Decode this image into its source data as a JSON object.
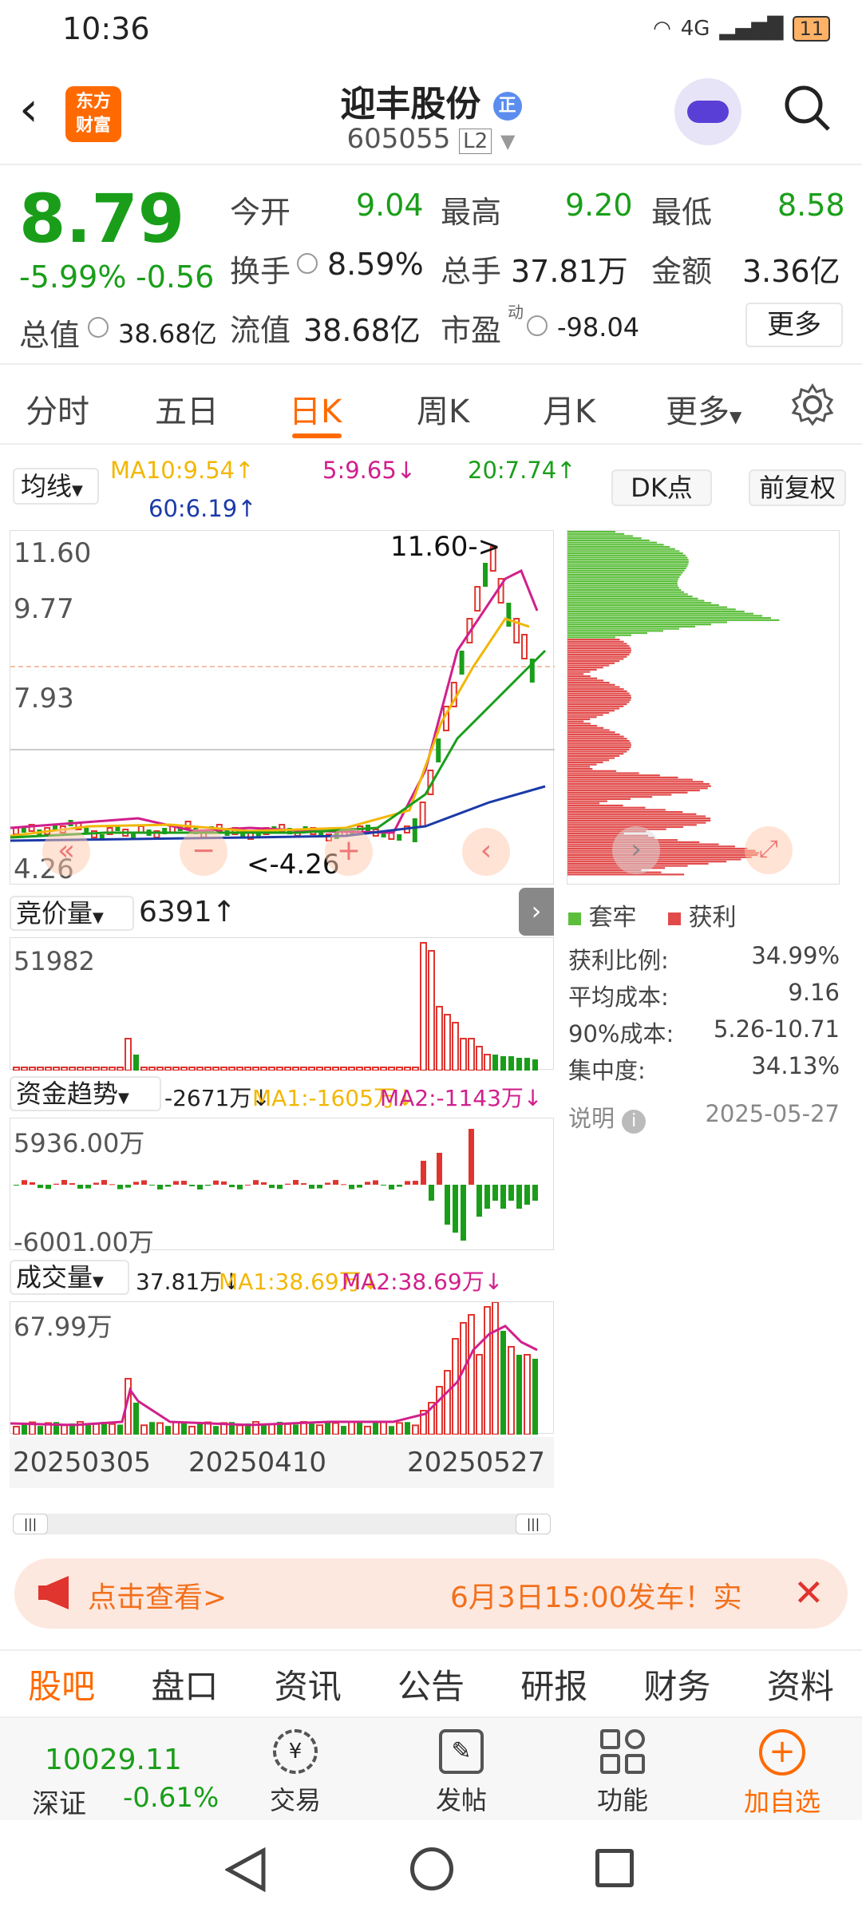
{
  "status": {
    "time": "10:36",
    "network": "4G",
    "battery": "11"
  },
  "header": {
    "logo_line1": "东方",
    "logo_line2": "财富",
    "stock_name": "迎丰股份",
    "badge": "正",
    "stock_code": "605055",
    "level": "L2"
  },
  "quote": {
    "price": "8.79",
    "change_pct": "-5.99%",
    "change": "-0.56",
    "open_label": "今开",
    "open": "9.04",
    "high_label": "最高",
    "high": "9.20",
    "low_label": "最低",
    "low": "8.58",
    "turnover_label": "换手",
    "turnover": "8.59%",
    "volume_label": "总手",
    "volume": "37.81万",
    "amount_label": "金额",
    "amount": "3.36亿",
    "mktcap_label": "总值",
    "mktcap": "38.68亿",
    "float_label": "流值",
    "float_cap": "38.68亿",
    "pe_label": "市盈",
    "pe_sup": "动",
    "pe": "-98.04",
    "more": "更多"
  },
  "tabs": [
    "分时",
    "五日",
    "日K",
    "周K",
    "月K",
    "更多"
  ],
  "kline": {
    "ma_selector": "均线",
    "ma10": "MA10:9.54↑",
    "ma5": "5:9.65↓",
    "ma20": "20:7.74↑",
    "ma60": "60:6.19↑",
    "dk_button": "DK点",
    "adjust_button": "前复权",
    "y_top": "11.60",
    "y_mid": "9.77",
    "y_low": "7.93",
    "y_bottom": "4.26",
    "peak_label": "11.60->",
    "trough_label": "<-4.26"
  },
  "chips": {
    "legend_trapped": "套牢",
    "legend_profit": "获利",
    "rows": [
      {
        "label": "获利比例:",
        "value": "34.99%"
      },
      {
        "label": "平均成本:",
        "value": "9.16"
      },
      {
        "label": "90%成本:",
        "value": "5.26-10.71"
      },
      {
        "label": "集中度:",
        "value": "34.13%"
      }
    ],
    "note": "说明",
    "date": "2025-05-27"
  },
  "auction": {
    "selector": "竞价量",
    "value": "6391↑",
    "y_top": "51982"
  },
  "fund": {
    "selector": "资金趋势",
    "value": "-2671万↓",
    "ma1": "MA1:-1605万↓",
    "ma2": "MA2:-1143万↓",
    "y_top": "5936.00万",
    "y_bottom": "-6001.00万"
  },
  "vol": {
    "selector": "成交量",
    "value": "37.81万↓",
    "ma1": "MA1:38.69万↓",
    "ma2": "MA2:38.69万↓",
    "y_top": "67.99万"
  },
  "dates": [
    "20250305",
    "20250410",
    "20250527"
  ],
  "banner": {
    "left": "点击查看>",
    "right": "6月3日15:00发车！实"
  },
  "bottom_tabs": [
    "股吧",
    "盘口",
    "资讯",
    "公告",
    "研报",
    "财务",
    "资料"
  ],
  "toolbar": {
    "index_value": "10029.11",
    "index_name": "深证",
    "index_change": "-0.61%",
    "trade": "交易",
    "post": "发帖",
    "function": "功能",
    "add": "加自选"
  },
  "colors": {
    "up": "#e0342f",
    "down": "#1a9e1a",
    "accent": "#ff6a00"
  }
}
